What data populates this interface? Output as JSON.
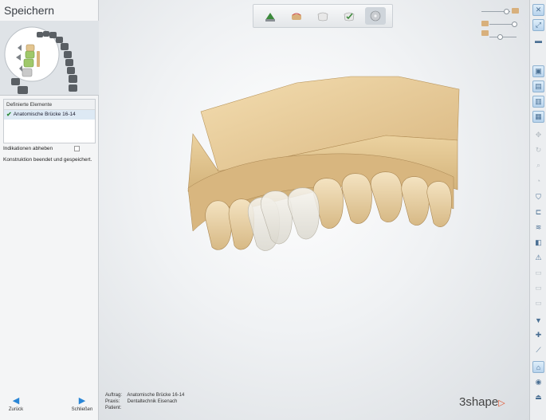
{
  "left_panel": {
    "title": "Speichern",
    "elements_header": "Definierte Elemente",
    "element_item": "Anatomische Brücke 16-14",
    "indications_label": "Indikationen abheben",
    "status_text": "Konstruktion beendet und gespeichert.",
    "back_label": "Zurück",
    "close_label": "Schließen"
  },
  "info": {
    "order_label": "Auftrag:",
    "order_value": "Anatomische Brücke 16-14",
    "practice_label": "Praxis:",
    "practice_value": "Dentaltechnik Eisenach",
    "patient_label": "Patient:",
    "patient_value": ""
  },
  "brand": {
    "name": "3shape"
  },
  "toolbar": {
    "steps": [
      "model-scan-icon",
      "margin-icon",
      "crown-icon",
      "checked-tooth-icon",
      "save-disc-icon"
    ],
    "active_step": 4
  },
  "right_toolbar": {
    "buttons": [
      "close-view-icon",
      "expand-icon",
      "hat-icon",
      "view-front-icon",
      "view-side-icon",
      "view-back-icon",
      "view-top-icon",
      "pan-icon",
      "rotate-icon",
      "zoom-icon",
      "lock-icon",
      "clip-icon",
      "section-icon",
      "warning-icon",
      "grid-icon",
      "scale-icon",
      "tooth-down-icon",
      "cross-section-icon",
      "measure-icon",
      "articulator-icon",
      "color-wheel-icon",
      "tooth-icon"
    ]
  },
  "colors": {
    "accent": "#2a86d6",
    "model": "#e3c58f",
    "brand_triangle": "#e0502a"
  }
}
